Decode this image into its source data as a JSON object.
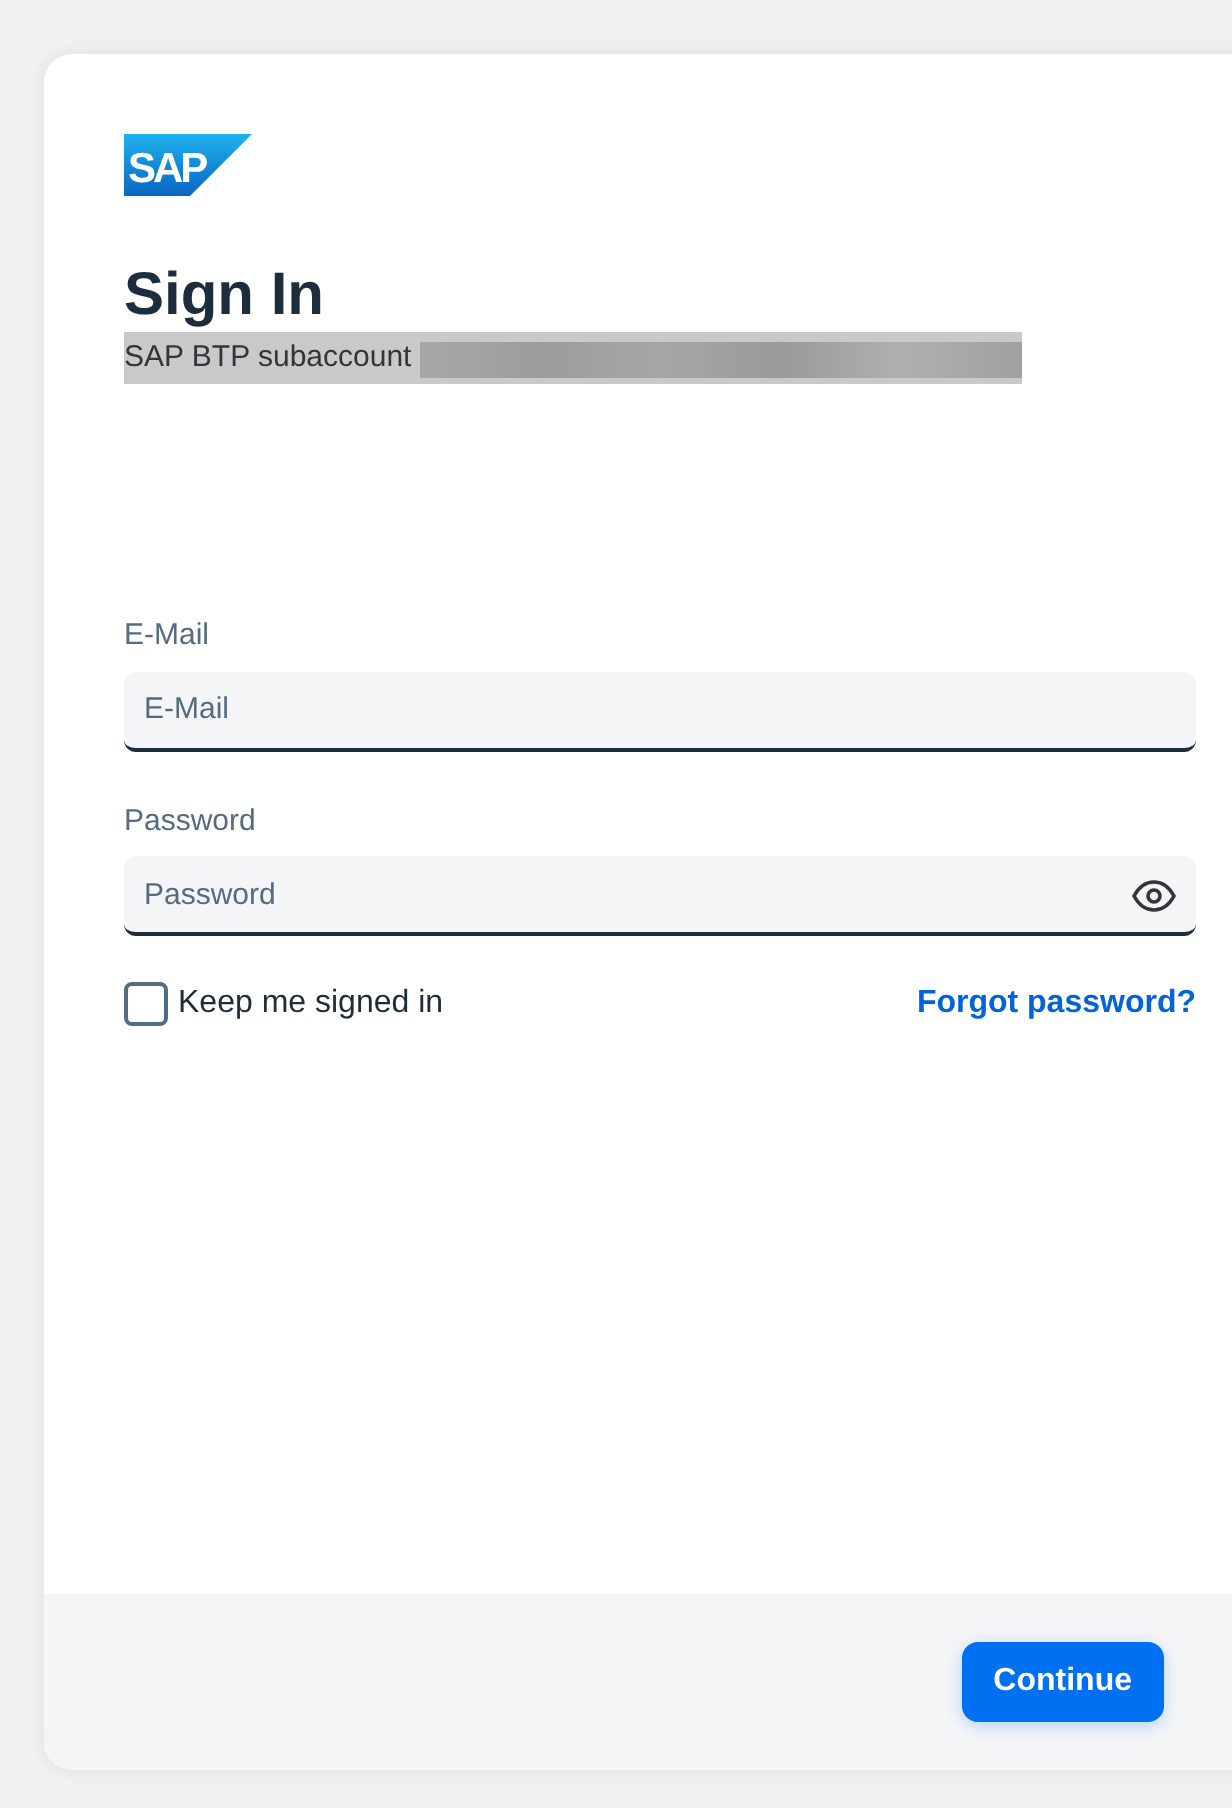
{
  "logo": "SAP",
  "title": "Sign In",
  "subtitle": "SAP BTP subaccount",
  "fields": [
    {
      "label": "E-Mail",
      "placeholder": "E-Mail",
      "kind": "text"
    },
    {
      "label": "Password",
      "placeholder": "Password",
      "kind": "password"
    }
  ],
  "keep_signed_in": {
    "label": "Keep me signed in",
    "checked": false
  },
  "forgot_link": "Forgot password?",
  "continue_button": "Continue"
}
